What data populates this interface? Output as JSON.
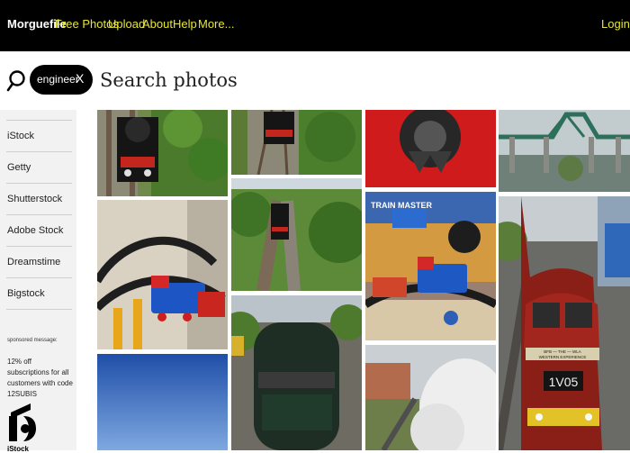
{
  "nav": {
    "brand": "Morguefile",
    "links": [
      "Free Photos",
      "Upload",
      "About",
      "Help",
      "More..."
    ],
    "login": "Login",
    "slash": "/"
  },
  "search": {
    "chip_label": "engineer",
    "chip_close": "X",
    "placeholder": "Search photos"
  },
  "sidebar": {
    "items": [
      "iStock",
      "Getty",
      "Shutterstock",
      "Adobe Stock",
      "Dreamstime",
      "Bigstock"
    ],
    "sponsored_label": "sponsored message:",
    "promo_text": "12% off subscriptions for all customers with code 12SUBIS",
    "logo_label": "iStock"
  },
  "photos": {
    "col3_packaging_brand": "TRAIN MASTER",
    "col4_plate_line1": "BFB — THE — WLA",
    "col4_plate_line2": "WESTERN EXPERIENCE",
    "col4_number": "1V05"
  },
  "colors": {
    "nav_bg": "#000000",
    "nav_link": "#e6e63a",
    "sidebar_bg": "#f2f2f2"
  }
}
